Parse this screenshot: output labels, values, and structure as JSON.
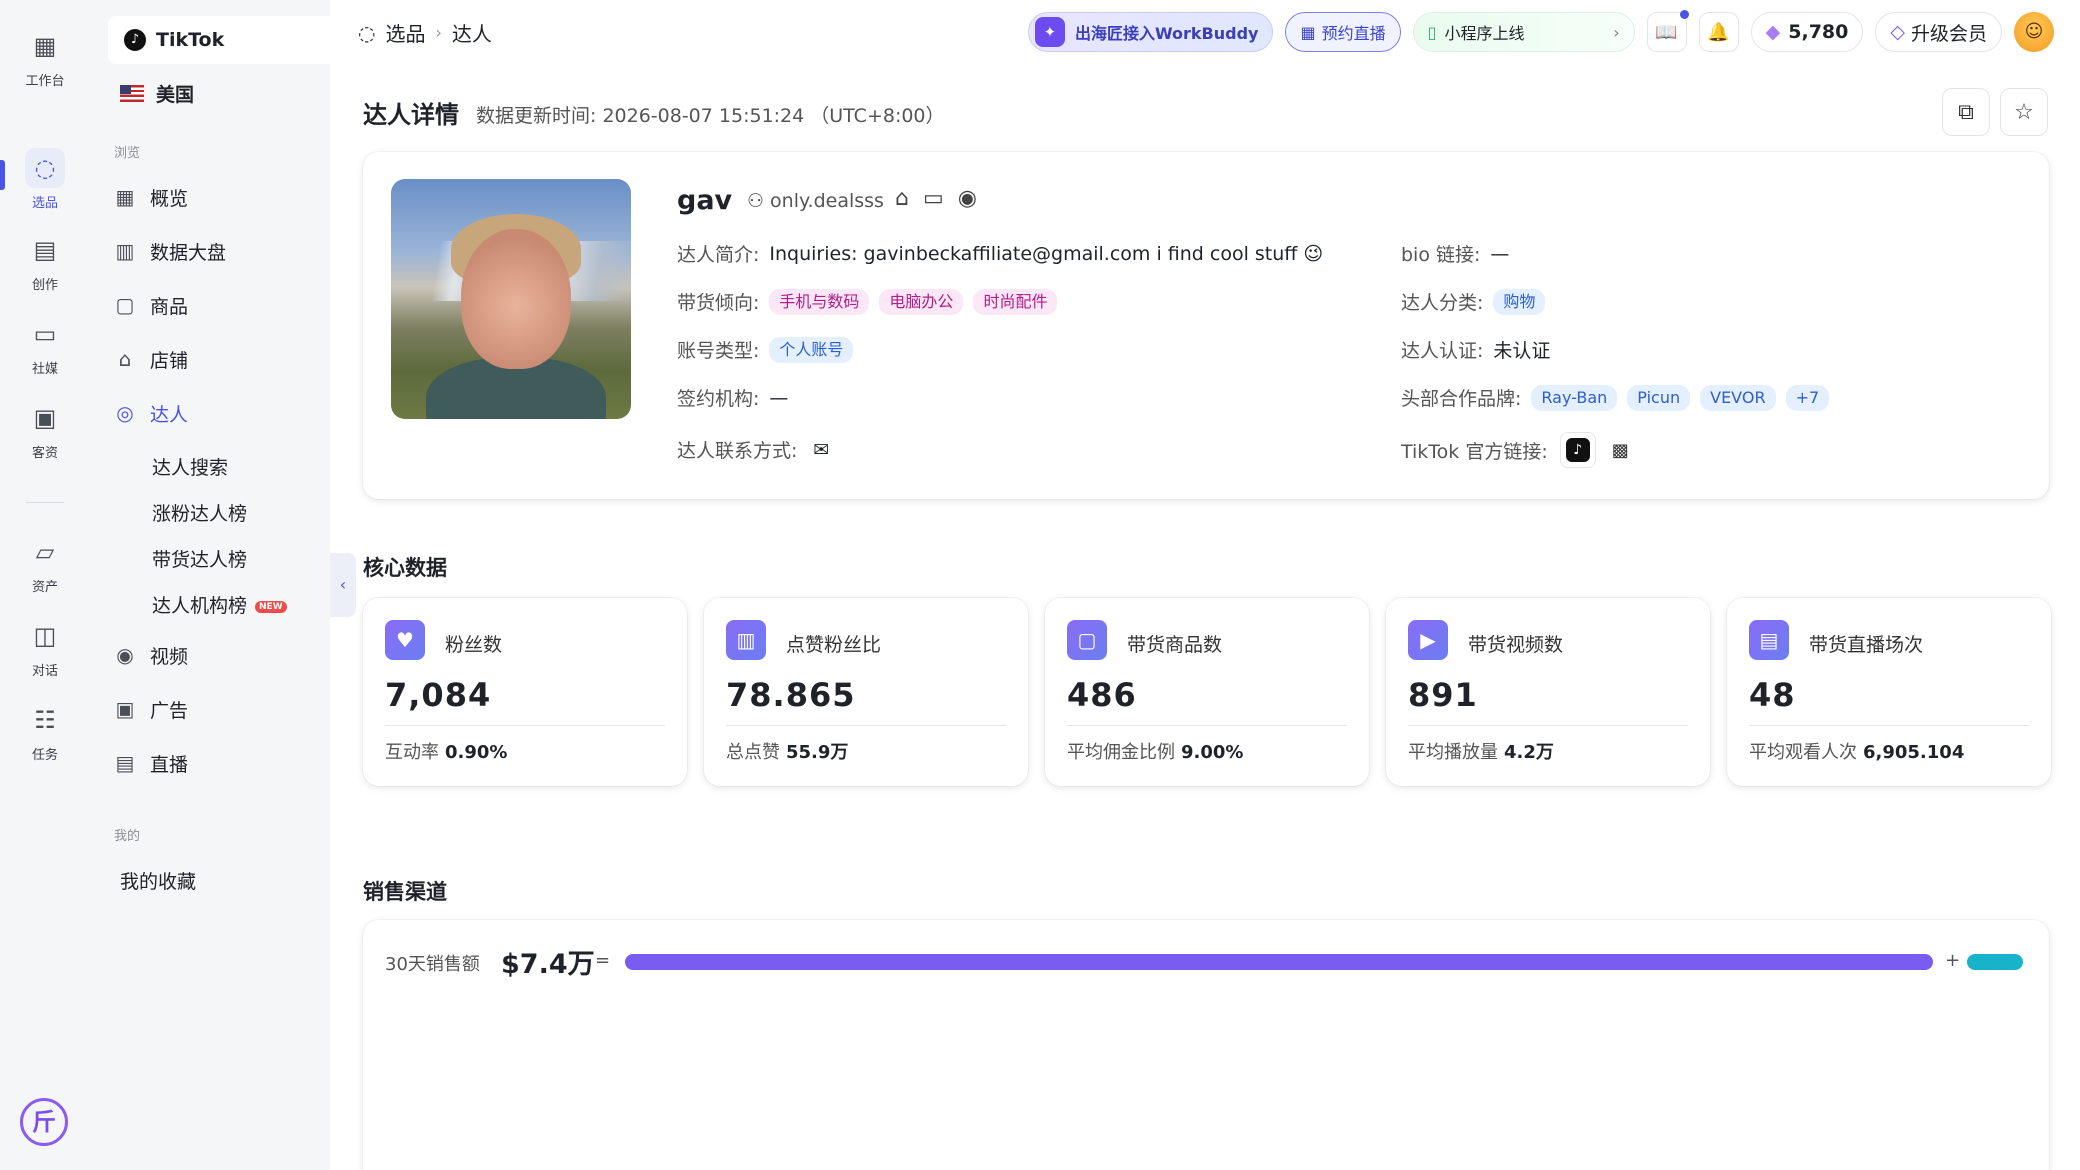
{
  "rail": {
    "items": [
      {
        "label": "工作台",
        "icon": "grid-icon"
      },
      {
        "label": "选品",
        "icon": "search-bubble-icon"
      },
      {
        "label": "创作",
        "icon": "clapper-icon"
      },
      {
        "label": "社媒",
        "icon": "chat-plus-icon"
      },
      {
        "label": "客资",
        "icon": "contact-card-icon"
      },
      {
        "label": "资产",
        "icon": "folder-icon"
      },
      {
        "label": "对话",
        "icon": "dialog-icon"
      },
      {
        "label": "任务",
        "icon": "checklist-icon"
      }
    ],
    "logo": "斤"
  },
  "nav": {
    "platform": "TikTok",
    "region": "美国",
    "section_browse": "浏览",
    "items": [
      {
        "label": "概览"
      },
      {
        "label": "数据大盘"
      },
      {
        "label": "商品"
      },
      {
        "label": "店铺"
      },
      {
        "label": "达人"
      },
      {
        "label": "视频"
      },
      {
        "label": "广告"
      },
      {
        "label": "直播"
      }
    ],
    "sub_items": [
      {
        "label": "达人搜索"
      },
      {
        "label": "涨粉达人榜"
      },
      {
        "label": "带货达人榜"
      },
      {
        "label": "达人机构榜",
        "badge": "NEW"
      }
    ],
    "section_mine": "我的",
    "favorites": "我的收藏"
  },
  "breadcrumb": {
    "root": "选品",
    "current": "达人"
  },
  "topbar": {
    "workbuddy": "出海匠接入WorkBuddy",
    "live_booking": "预约直播",
    "miniprogram": "小程序上线",
    "points": "5,780",
    "vip": "升级会员"
  },
  "page": {
    "title": "达人详情",
    "updated": "数据更新时间: 2026-08-07 15:51:24 （UTC+8:00）"
  },
  "profile": {
    "name": "gav",
    "handle": "only.dealsss",
    "bio_label": "达人简介:",
    "bio": "Inquiries: gavinbeckaffiliate@gmail.com i find cool stuff 😉",
    "bio_link_label": "bio 链接:",
    "bio_link": "—",
    "tendency_label": "带货倾向:",
    "tendencies": [
      "手机与数码",
      "电脑办公",
      "时尚配件"
    ],
    "category_label": "达人分类:",
    "category": "购物",
    "account_type_label": "账号类型:",
    "account_type": "个人账号",
    "verify_label": "达人认证:",
    "verify": "未认证",
    "agency_label": "签约机构:",
    "agency": "—",
    "brands_label": "头部合作品牌:",
    "brands": [
      "Ray-Ban",
      "Picun",
      "VEVOR",
      "+7"
    ],
    "contact_label": "达人联系方式:",
    "tiktok_label": "TikTok 官方链接:"
  },
  "core": {
    "title": "核心数据",
    "metrics": [
      {
        "label": "粉丝数",
        "value": "7,084",
        "sub_label": "互动率",
        "sub_value": "0.90%",
        "icon": "fans-icon"
      },
      {
        "label": "点赞粉丝比",
        "value": "78.865",
        "sub_label": "总点赞",
        "sub_value": "55.9万",
        "icon": "like-ratio-icon"
      },
      {
        "label": "带货商品数",
        "value": "486",
        "sub_label": "平均佣金比例",
        "sub_value": "9.00%",
        "icon": "shopping-bag-icon"
      },
      {
        "label": "带货视频数",
        "value": "891",
        "sub_label": "平均播放量",
        "sub_value": "4.2万",
        "icon": "video-icon"
      },
      {
        "label": "带货直播场次",
        "value": "48",
        "sub_label": "平均观看人次",
        "sub_value": "6,905.104",
        "icon": "live-icon"
      }
    ]
  },
  "sales": {
    "title": "销售渠道",
    "label": "30天销售额",
    "value": "$7.4万",
    "eq": "=",
    "plus": "+",
    "share_video": 0.96,
    "share_live": 0.04,
    "colors": {
      "video": "#7a5cf0",
      "live": "#17b3c9"
    }
  }
}
